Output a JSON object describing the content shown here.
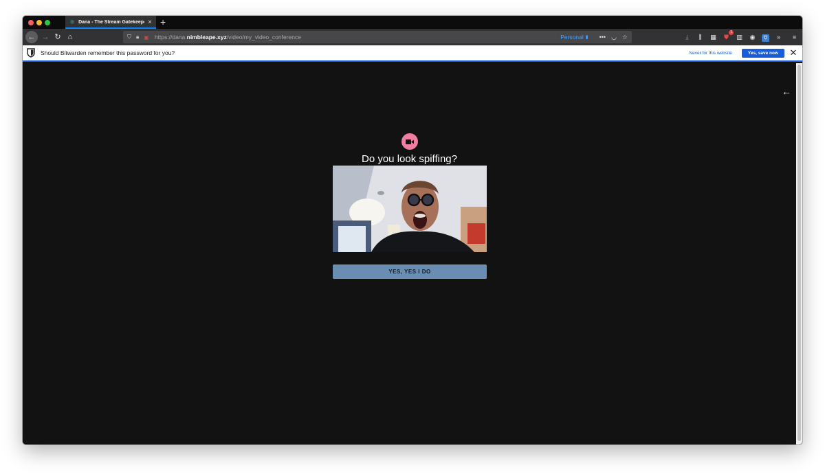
{
  "browser": {
    "tab": {
      "title": "Dana - The Stream Gatekeeper",
      "favicon": "atom-icon"
    },
    "url": {
      "prefix": "https://dana.",
      "domain": "nimbleape.xyz",
      "path": "/video/my_video_conference"
    },
    "container_label": "Personal",
    "toolbar_badge_count": "1"
  },
  "notification": {
    "message": "Should Bitwarden remember this password for you?",
    "never_label": "Never for this website",
    "save_label": "Yes, save now"
  },
  "page": {
    "headline": "Do you look spiffing?",
    "confirm_label": "YES, YES I DO",
    "accent_color": "#f27da2",
    "button_color": "#6a8db4"
  }
}
